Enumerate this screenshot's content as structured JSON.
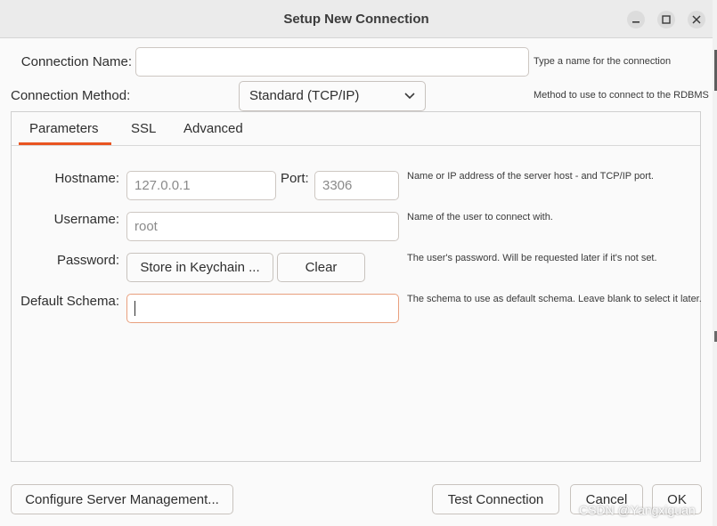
{
  "window": {
    "title": "Setup New Connection"
  },
  "connection_name": {
    "label": "Connection Name:",
    "value": "",
    "hint": "Type a name for the connection"
  },
  "connection_method": {
    "label": "Connection Method:",
    "value": "Standard (TCP/IP)",
    "hint": "Method to use to connect to the RDBMS"
  },
  "tabs": [
    {
      "label": "Parameters",
      "active": true
    },
    {
      "label": "SSL"
    },
    {
      "label": "Advanced"
    }
  ],
  "params": {
    "hostname": {
      "label": "Hostname:",
      "value": "127.0.0.1"
    },
    "port": {
      "label": "Port:",
      "value": "3306"
    },
    "hostname_hint": "Name or IP address of the server host - and TCP/IP port.",
    "username": {
      "label": "Username:",
      "value": "root",
      "hint": "Name of the user to connect with."
    },
    "password": {
      "label": "Password:",
      "store_label": "Store in Keychain ...",
      "clear_label": "Clear",
      "hint": "The user's password. Will be requested later if it's not set."
    },
    "default_schema": {
      "label": "Default Schema:",
      "value": "",
      "hint": "The schema to use as default schema. Leave blank to select it later."
    }
  },
  "footer": {
    "configure_label": "Configure Server Management...",
    "test_label": "Test Connection",
    "cancel_label": "Cancel",
    "ok_label": "OK"
  },
  "watermark": "CSDN @Yangxiguan",
  "colors": {
    "accent": "#e95420",
    "focus_border": "#e9a07e"
  }
}
